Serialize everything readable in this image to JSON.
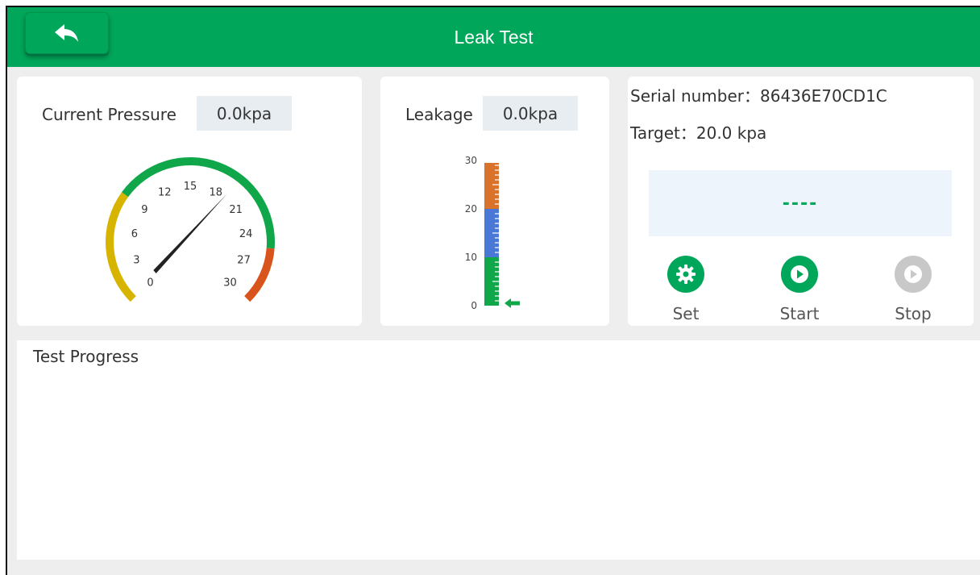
{
  "header": {
    "title": "Leak Test"
  },
  "pressure": {
    "label": "Current Pressure",
    "value": "0.0kpa",
    "gauge_ticks": [
      "0",
      "3",
      "6",
      "9",
      "12",
      "15",
      "18",
      "21",
      "24",
      "27",
      "30"
    ],
    "gauge_value": 0
  },
  "leakage": {
    "label": "Leakage",
    "value": "0.0kpa",
    "scale": [
      "0",
      "10",
      "20",
      "30"
    ],
    "level": 0
  },
  "info": {
    "serial_line": "Serial number：86436E70CD1C",
    "target_line": "Target：20.0 kpa",
    "status_text": "----"
  },
  "actions": {
    "set": "Set",
    "start": "Start",
    "stop": "Stop"
  },
  "progress": {
    "title": "Test Progress"
  },
  "colors": {
    "accent": "#00a65a",
    "gauge_yellow": "#d6b400",
    "gauge_green": "#10a64a",
    "gauge_red": "#d9541c",
    "bar_orange": "#d9722a",
    "bar_blue": "#4a78d6",
    "stop_disabled": "#c8c8c8"
  }
}
